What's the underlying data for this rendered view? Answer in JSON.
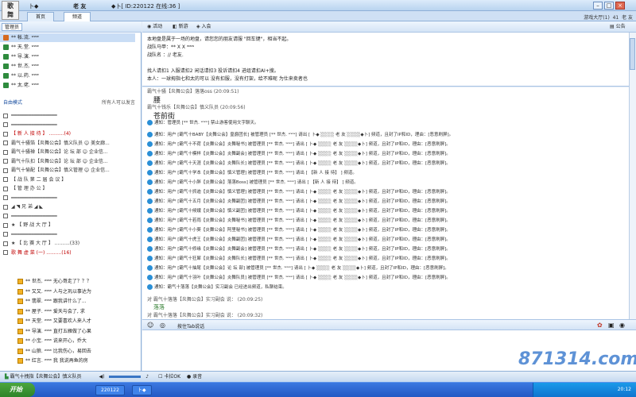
{
  "titlebar": {
    "app_text": "卜◆",
    "name": "老 友",
    "id_text": "◆卜[ ID:220122 在线:36 ]",
    "logo_text": "歌\n舞"
  },
  "tabs": [
    {
      "label": "首页"
    },
    {
      "label": "频道"
    }
  ],
  "top_right": {
    "game_hall": "游戏大厅(1)",
    "count": "41",
    "user_label": "老 友"
  },
  "left": {
    "admin_button": "管理员",
    "admins": [
      {
        "name": "** 帐.流.    ʷʷʷ",
        "selected": true,
        "color": "#d66a1f"
      },
      {
        "name": "** 天.堂.    ʷʷʷ",
        "selected": false,
        "color": "#2e8b3d"
      },
      {
        "name": "** 导.演.    ʷʷʷ",
        "selected": false,
        "color": "#2e8b3d"
      },
      {
        "name": "** 世.杰.    ʷʷʷ",
        "selected": false,
        "color": "#2e8b3d"
      },
      {
        "name": "** 以.药.    ʷʷʷ",
        "selected": false,
        "color": "#2e8b3d"
      },
      {
        "name": "** 太.佬.    ʷʷʷ",
        "selected": false,
        "color": "#2e8b3d"
      }
    ],
    "mode": "自由模式",
    "mode_right": "所有人可以发言",
    "channels": [
      {
        "text": "━━━━━━━━━━━━━━━━",
        "cls": ""
      },
      {
        "text": "━━━━━━━━━━━━━━━━",
        "cls": ""
      },
      {
        "text": "【 新 人 接 待 】 ..........(4)",
        "cls": "red"
      },
      {
        "text": "霸气十骚箔【炎舞公会】慎义队员  ☺ 美女廊...",
        "cls": ""
      },
      {
        "text": "霸气十骚禅【炎舞公会】论 坛 部  ☺ 企业信...",
        "cls": ""
      },
      {
        "text": "霸气十队扣【炎舞公会】论 坛 部  ☺ 企业信...",
        "cls": ""
      },
      {
        "text": "霸气十愉配【炎舞公会】慎义管理  ☺ 企业信...",
        "cls": ""
      },
      {
        "text": "【 战 队 第 二 届 会 议 】",
        "cls": ""
      },
      {
        "text": "【 管 理 办 公 】",
        "cls": ""
      },
      {
        "text": "━━━━━━━━━━━━━━━━",
        "cls": ""
      },
      {
        "text": "◢ ◥ 兄        弟 ◢ ◣",
        "cls": ""
      },
      {
        "text": "━━━━━━━━━━━━━━━━",
        "cls": ""
      },
      {
        "text": "★ 【 野 战 大 厅 】",
        "cls": ""
      },
      {
        "text": "━━━━━━━━━━━━━━━━",
        "cls": ""
      },
      {
        "text": "★ 【 比 赛 大 厅 】 ..........(33)",
        "cls": ""
      },
      {
        "text": "歌 舞 虚 菜 (一) ..........(16)",
        "cls": "red"
      }
    ],
    "users": [
      {
        "name": "** 世杰.     ʷʷʷ 无心哥走了？？？"
      },
      {
        "name": "** 又又.     ʷʷʷ 人与之巩以事达为"
      },
      {
        "name": "** 翡翠.     ʷʷʷ 跟我讲什么了..."
      },
      {
        "name": "** 屋子.     ʷʷʷ 爱天与会了, 求"
      },
      {
        "name": "** 天堂.     ʷʷʷ 又要喜欢人来人才"
      },
      {
        "name": "** 导演.     ʷʷʷ 直打五雁做了心果"
      },
      {
        "name": "** 小宝.     ʷʷʷ 说来开心，乔大"
      },
      {
        "name": "** 山狼.     ʷʷʷ 比我伤心，易回去"
      },
      {
        "name": "** 红言.     ʷʷʷ 我 我说再鱼的房"
      }
    ]
  },
  "toolbar": {
    "activity": "活动",
    "news": "新游",
    "join": "入会",
    "notice": "公告"
  },
  "announce": {
    "lines": [
      "本地盘是属于一场的地盘，请您您的朋友请服 \"回车键\"，相当不起。",
      "战队马甲：**     X X         ʷʷʷ",
      "战队名 ：//     老友.",
      "",
      "找人请扣1   入服请扣2   闲话请扣3   投诉请扣4   进组请扣AI+搜。",
      "本人：一球拇指七和太的可以  没有扣服，没有打架，给不难呢 为仕来卖者也"
    ]
  },
  "chat": {
    "meta1": "霸气十骚【炎舞公会】落落oss (20:09:51)",
    "big1": "腰",
    "meta2": "霸气十钱乐【炎舞公会】慎义队员 (20:09:56)",
    "big2": "苍前街",
    "notice1": "通知：管理员 [**     世杰.       ʷʷʷ] 禁止游客使用文字聊天。",
    "sys_lines": [
      "通知：用户 [霸气十BABY【炎舞公会】皇爵团长] 被管理员 [**     世杰.       ʷʷʷ] 请出 [ 卜◆ ░░░░ 老 友 ░░░░◆卜] 频道，且封了IP和ID，理由：[恶意刷屏]。",
      "通知：用户 [霸气十不荷【炎舞公会】炎舞秘书] 被管理员 [**     世杰.       ʷʷʷ] 请出 [ 卜◆ ░░░░ 老 友 ░░░░◆卜] 频道，且封了IP和ID，理由：[恶意刷屏]。",
      "通知：用户 [霸气十模样【炎舞公会】炎舞副会] 被管理员 [**     世杰.       ʷʷʷ] 请出 [ 卜◆ ░░░░ 老 友 ░░░░◆卜] 频道，且封了IP和ID，理由：[恶意刷屏]。",
      "通知：用户 [霸气十天涯【炎舞公会】炎舞队长] 被管理员 [**     世杰.       ʷʷʷ] 请出 [ 卜◆ ░░░░ 老 友 ░░░░◆卜] 频道，且封了IP和ID，理由：[恶意刷屏]。",
      "通知：用户 [霸气十学本【炎舞公会】慎义管理] 被管理员 [**     世杰.       ʷʷʷ] 请出 [        【新 人 接 待】        ] 频道。",
      "通知：用户 [霸气十小胖【炎舞公会】落落Boss] 被管理员 [**     世杰.       ʷʷʷ] 请出 [        【新 人 接 待】        ] 频道。",
      "通知：用户 [霸气十抓迪【炎舞公会】慎义管理] 被管理员 [**     世杰.       ʷʷʷ] 请出 [ 卜◆ ░░░░ 老 友 ░░░░◆卜] 频道，且封了IP和ID，理由：[恶意刷屏]。",
      "通知：用户 [霸气十五月【炎舞公会】炎舞副团] 被管理员 [**     世杰.       ʷʷʷ] 请出 [ 卜◆ ░░░░ 老 友 ░░░░◆卜] 频道，且封了IP和ID，理由：[恶意刷屏]。",
      "通知：用户 [霸气十候娥【炎舞公会】慎义副团] 被管理员 [**     世杰.       ʷʷʷ] 请出 [ 卜◆ ░░░░ 老 友 ░░░░◆卜] 频道，且封了IP和ID，理由：[恶意刷屏]。",
      "通知：用户 [霸气十若雨【炎舞公会】炎舞秘书] 被管理员 [**     世杰.       ʷʷʷ] 请出 [ 卜◆ ░░░░ 老 友 ░░░░◆卜] 频道，且封了IP和ID，理由：[恶意刷屏]。",
      "通知：用户 [霸气十小葵【炎舞公会】阿里秘书] 被管理员 [**     世杰.       ʷʷʷ] 请出 [ 卜◆ ░░░░ 老 友 ░░░░◆卜] 频道，且封了IP和ID，理由：[恶意刷屏]。",
      "通知：用户 [霸气十虎王【炎舞公会】炎舞副团] 被管理员 [**     世杰.       ʷʷʷ] 请出 [ 卜◆ ░░░░ 老 友 ░░░░◆卜] 频道，且封了IP和ID，理由：[恶意刷屏]。",
      "通知：用户 [霸气十修缘【炎舞公会】炎舞副会] 被管理员 [**     世杰.       ʷʷʷ] 请出 [ 卜◆ ░░░░ 老 友 ░░░░◆卜] 频道，且封了IP和ID，理由：[恶意刷屏]。",
      "通知：用户 [霸气十狂犀【炎舞公会】炎舞队长] 被管理员 [**     世杰.       ʷʷʷ] 请出 [ 卜◆ ░░░░ 老 友 ░░░░◆卜] 频道，且封了IP和ID，理由：[恶意刷屏]。",
      "通知：用户 [霸气十抽尾【炎舞公会】论 坛 部] 被管理员 [**     世杰.       ʷʷʷ] 请出 [ 卜◆ ░░░░ 老 友 ░░░░◆卜] 频道，且封了IP和ID，理由：[恶意刷屏]。",
      "通知：用户 [霸气十羽叶【炎舞公会】炎舞队员] 被管理员 [**     世杰.       ʷʷʷ] 请出 [ 卜◆ ░░░░ 老 友 ░░░░◆卜] 频道，且封了IP和ID，理由：[恶意刷屏]。"
    ],
    "notice2": "通知：霸气十落落【炎舞公会】实习副会 已经进出频道，私聊结束。",
    "meta3": "对 霸气十落落【炎舞公会】实习副会 说：  (20:09:25)",
    "line3": "落落",
    "meta4": "对 霸气十落落【炎舞公会】实习副会 说：  (20:09:32)"
  },
  "inputbar": {
    "hint": "按住Tab说话"
  },
  "bottombar": {
    "user": "霸气十拽指【炎舞公会】慎义队员",
    "loop": "卡拉OK",
    "record": "录音"
  },
  "taskbar": {
    "start": "开始",
    "tasks": [
      "220122",
      "卜◆"
    ],
    "clock": "20:12"
  },
  "watermark": "871314.com"
}
